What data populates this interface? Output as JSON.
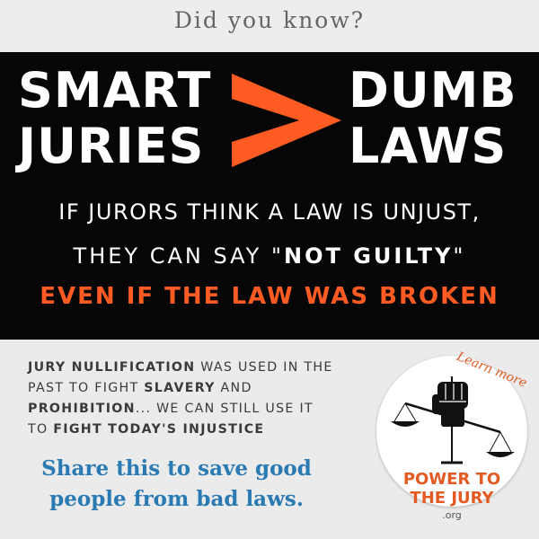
{
  "header": {
    "text": "Did you know?"
  },
  "headline": {
    "left_line1": "SMART",
    "left_line2": "JURIES",
    "right_line1": "DUMB",
    "right_line2": "LAWS"
  },
  "message": {
    "line1": "IF JURORS THINK A LAW IS UNJUST,",
    "line2_prefix": "THEY CAN SAY \"",
    "line2_bold": "NOT GUILTY",
    "line2_suffix": "\"",
    "line3": "EVEN IF THE LAW WAS BROKEN"
  },
  "paragraph": {
    "p1_bold": "JURY NULLIFICATION",
    "p1": " WAS USED IN THE PAST TO FIGHT ",
    "p2_bold": "SLAVERY",
    "p2": " AND ",
    "p3_bold": "PROHIBITION",
    "p3": "... WE CAN STILL USE IT TO ",
    "p4_bold": "FIGHT TODAY'S INJUSTICE"
  },
  "share": {
    "line1": "Share this to save good",
    "line2": "people from bad laws."
  },
  "badge": {
    "learn_more": "Learn more",
    "title_line1": "POWER TO",
    "title_line2": "THE JURY",
    "org": ".org"
  },
  "colors": {
    "orange": "#ff5b22",
    "blue": "#2a7ab3",
    "black": "#060606"
  }
}
